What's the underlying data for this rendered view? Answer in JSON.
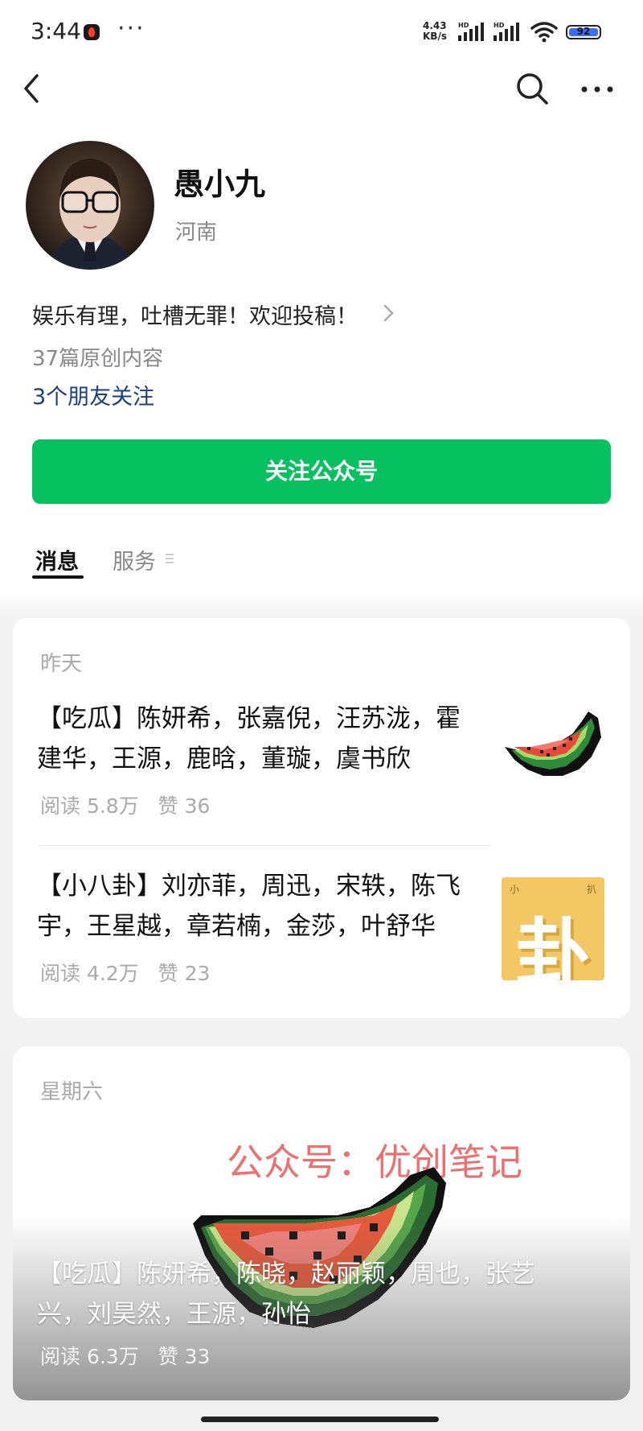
{
  "status_bar": {
    "time": "3:44",
    "more": "···",
    "net_speed_value": "4.43",
    "net_speed_unit": "KB/s",
    "sim_label": "HD",
    "battery": "92"
  },
  "account": {
    "name": "愚小九",
    "region": "河南",
    "intro": "娱乐有理，吐槽无罪！欢迎投稿！",
    "original_count": "37篇原创内容",
    "friends_following": "3个朋友关注",
    "follow_button": "关注公众号"
  },
  "tabs": {
    "messages": "消息",
    "services": "服务"
  },
  "feed": {
    "group1": {
      "date": "昨天",
      "articles": [
        {
          "title_line1": "【吃瓜】陈妍希，张嘉倪，汪苏泷，霍",
          "title_line2": "建华，王源，鹿晗，董璇，虞书欣",
          "reads": "阅读 5.8万",
          "likes": "赞 36",
          "thumb": "watermelon-pixel-icon"
        },
        {
          "title_line1": "【小八卦】刘亦菲，周迅，宋轶，陈飞",
          "title_line2": "宇，王星越，章若楠，金莎，叶舒华",
          "reads": "阅读 4.2万",
          "likes": "赞 23",
          "thumb_char": "卦",
          "thumb_small_left": "小",
          "thumb_small_right": "扒"
        }
      ]
    },
    "group2": {
      "date": "星期六",
      "watermark": "公众号：优创笔记",
      "article": {
        "title_line1": "【吃瓜】陈妍希，陈晓，赵丽颖，周也，张艺",
        "title_line2": "兴，刘昊然，王源，孙怡",
        "reads": "阅读 6.3万",
        "likes": "赞 33"
      }
    }
  },
  "colors": {
    "accent_green": "#07c160",
    "link_blue": "#1b3f7a",
    "watermark_red": "#e85050"
  }
}
